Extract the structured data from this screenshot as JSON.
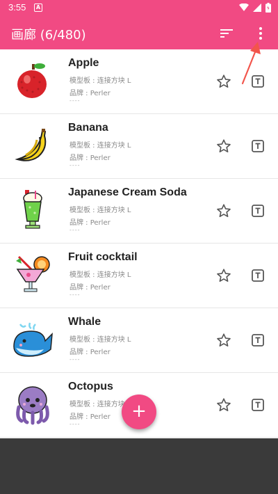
{
  "status": {
    "time": "3:55",
    "a_icon": "A"
  },
  "appbar": {
    "title": "画廊 (6/480)",
    "sort_icon": "sort-icon",
    "more_icon": "more-vert-icon"
  },
  "items": [
    {
      "name": "Apple",
      "board": "模型板 : 连接方块 L",
      "brand": "品牌 : Perler",
      "dashes": "----"
    },
    {
      "name": "Banana",
      "board": "模型板 : 连接方块 L",
      "brand": "品牌 : Perler",
      "dashes": "----"
    },
    {
      "name": "Japanese Cream Soda",
      "board": "模型板 : 连接方块 L",
      "brand": "品牌 : Perler",
      "dashes": "----"
    },
    {
      "name": "Fruit cocktail",
      "board": "模型板 : 连接方块 L",
      "brand": "品牌 : Perler",
      "dashes": "----"
    },
    {
      "name": "Whale",
      "board": "模型板 : 连接方块 L",
      "brand": "品牌 : Perler",
      "dashes": "----"
    },
    {
      "name": "Octopus",
      "board": "模型板 : 连接方块 L",
      "brand": "品牌 : Perler",
      "dashes": "----"
    }
  ],
  "fab": {
    "label": "+"
  },
  "colors": {
    "accent": "#f14a83",
    "bottom": "#3a3a3a",
    "arrow": "#f2554c"
  }
}
